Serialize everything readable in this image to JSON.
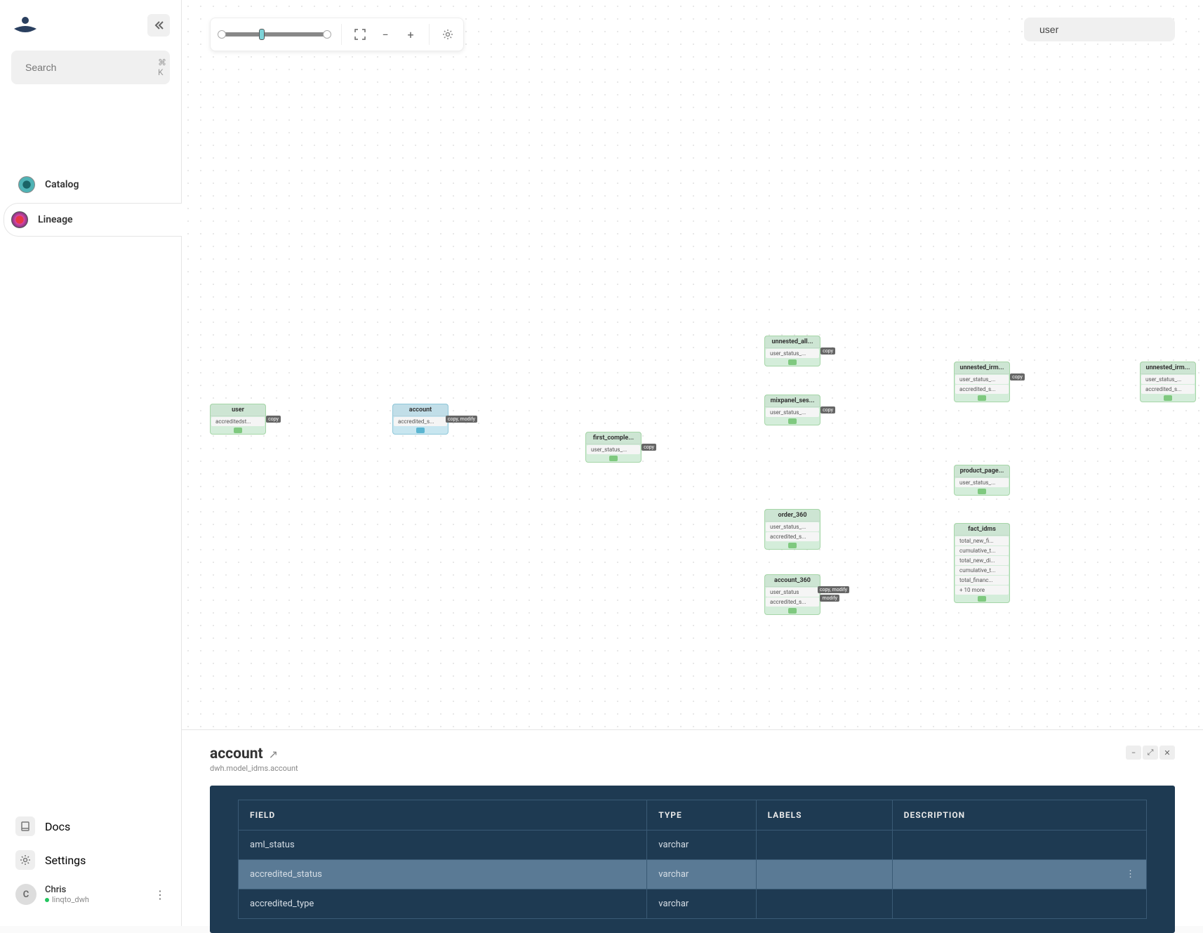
{
  "sidebar": {
    "search_placeholder": "Search",
    "search_kbd": "⌘ K",
    "nav": [
      {
        "label": "Catalog"
      },
      {
        "label": "Lineage"
      }
    ],
    "bottom": [
      {
        "label": "Docs"
      },
      {
        "label": "Settings"
      }
    ],
    "user": {
      "initial": "C",
      "name": "Chris",
      "workspace": "linqto_dwh"
    }
  },
  "toolbar": {
    "slider_min": "1",
    "slider_max": "2"
  },
  "top_search": {
    "value": "user"
  },
  "nodes": {
    "user": {
      "title": "user",
      "rows": [
        "accreditedst..."
      ]
    },
    "account": {
      "title": "account",
      "rows": [
        "accredited_s..."
      ],
      "badge": "copy, modify"
    },
    "first_comple": {
      "title": "first_comple...",
      "rows": [
        "user_status_..."
      ],
      "badge": "copy"
    },
    "unnested_all": {
      "title": "unnested_all...",
      "rows": [
        "user_status_..."
      ],
      "badge": "copy"
    },
    "mixpanel_ses": {
      "title": "mixpanel_ses...",
      "rows": [
        "user_status_..."
      ],
      "badge": "copy"
    },
    "order_360": {
      "title": "order_360",
      "rows": [
        "user_status_...",
        "accredited_s..."
      ]
    },
    "account_360": {
      "title": "account_360",
      "rows": [
        "user_status",
        "accredited_s..."
      ],
      "badge1": "copy, modify",
      "badge2": "modify"
    },
    "unnested_irm": {
      "title": "unnested_irm...",
      "rows": [
        "user_status_...",
        "accredited_s..."
      ],
      "badge": "copy"
    },
    "product_page": {
      "title": "product_page...",
      "rows": [
        "user_status_..."
      ]
    },
    "fact_idms": {
      "title": "fact_idms",
      "rows": [
        "total_new_fi...",
        "cumulative_t...",
        "total_new_di...",
        "cumulative_t...",
        "total_financ...",
        "+ 10 more"
      ]
    },
    "unnested_irm2": {
      "title": "unnested_irm...",
      "rows": [
        "user_status_...",
        "accredited_s..."
      ]
    }
  },
  "detail": {
    "title": "account",
    "path": "dwh.model_idms.account",
    "columns": [
      "FIELD",
      "TYPE",
      "LABELS",
      "DESCRIPTION"
    ],
    "rows": [
      {
        "field": "aml_status",
        "type": "varchar",
        "labels": "",
        "description": "",
        "selected": false
      },
      {
        "field": "accredited_status",
        "type": "varchar",
        "labels": "",
        "description": "",
        "selected": true
      },
      {
        "field": "accredited_type",
        "type": "varchar",
        "labels": "",
        "description": "",
        "selected": false
      }
    ]
  }
}
